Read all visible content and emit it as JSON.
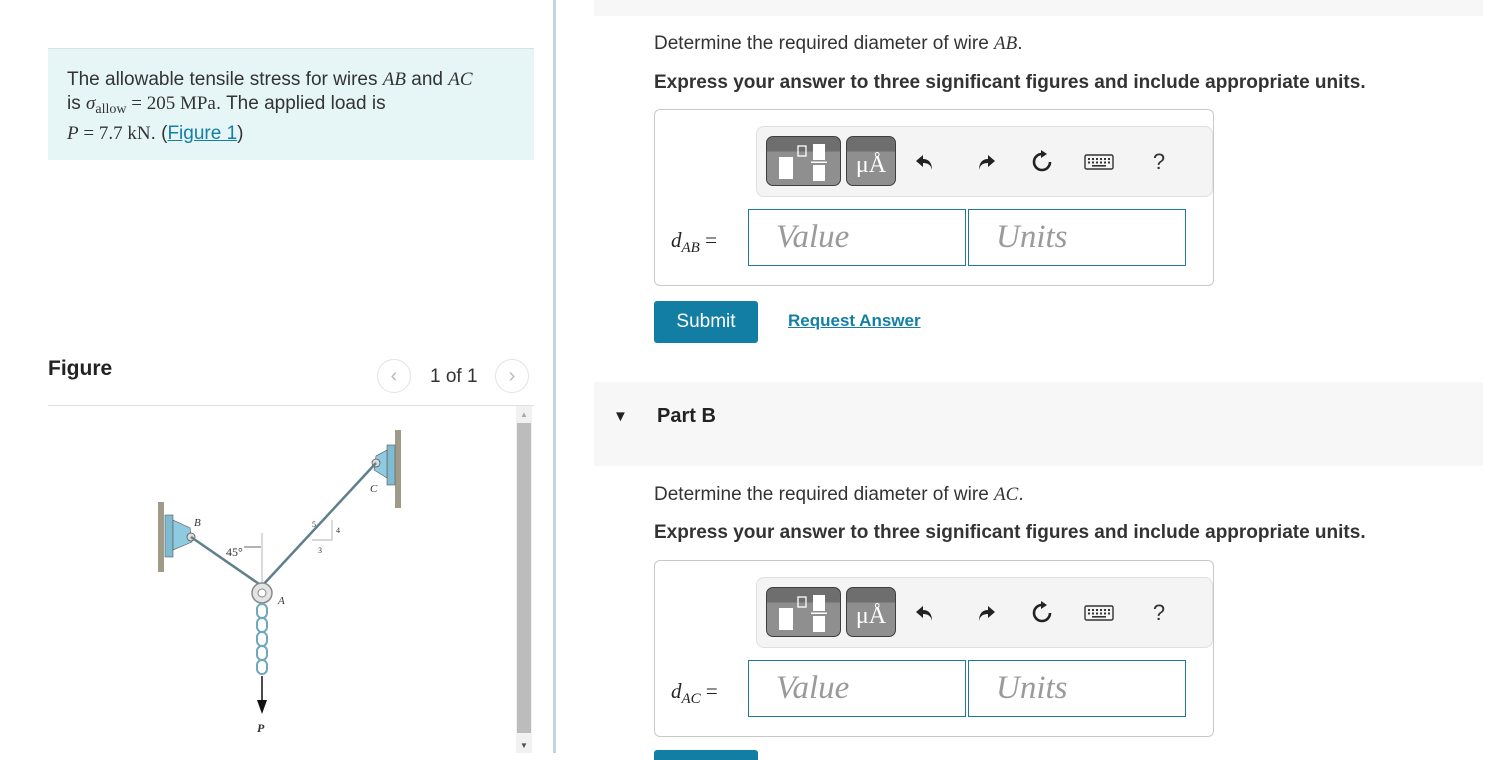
{
  "intro": {
    "line1_text": "The allowable tensile stress for wires ",
    "wire1": "AB",
    "and": " and ",
    "wire2": "AC",
    "line2_is": "is ",
    "sigma": "σ",
    "sigma_sub": "allow",
    "equals": " = ",
    "stress_value": "205 MPa",
    "line2_rest": ". The applied load is",
    "load_symbol": "P",
    "load_value": "7.7 kN",
    "period": ". (",
    "figure_link": "Figure 1",
    "close": ")"
  },
  "figure_panel": {
    "title": "Figure",
    "counter": "1 of 1",
    "prev_icon": "‹",
    "next_icon": "›",
    "labels": {
      "B": "B",
      "C": "C",
      "A": "A",
      "P": "P",
      "angle": "45°",
      "slope_hyp": "5",
      "slope_rise": "4",
      "slope_run": "3"
    }
  },
  "part_a": {
    "question_prefix": "Determine the required diameter of wire ",
    "question_var": "AB",
    "question_suffix": ".",
    "instruction": "Express your answer to three significant figures and include appropriate units.",
    "var_symbol": "d",
    "var_sub": "AB",
    "value_placeholder": "Value",
    "units_placeholder": "Units",
    "submit_label": "Submit",
    "request_answer_label": "Request Answer"
  },
  "part_b": {
    "header": "Part B",
    "toggle_icon": "▼",
    "question_prefix": "Determine the required diameter of wire ",
    "question_var": "AC",
    "question_suffix": ".",
    "instruction": "Express your answer to three significant figures and include appropriate units.",
    "var_symbol": "d",
    "var_sub": "AC",
    "value_placeholder": "Value",
    "units_placeholder": "Units"
  },
  "toolbar": {
    "units_button_label": "μÅ",
    "help_label": "?"
  },
  "colors": {
    "accent": "#137ea3",
    "intro_bg": "#e6f5f6",
    "part_header_bg": "#f7f7f7"
  }
}
